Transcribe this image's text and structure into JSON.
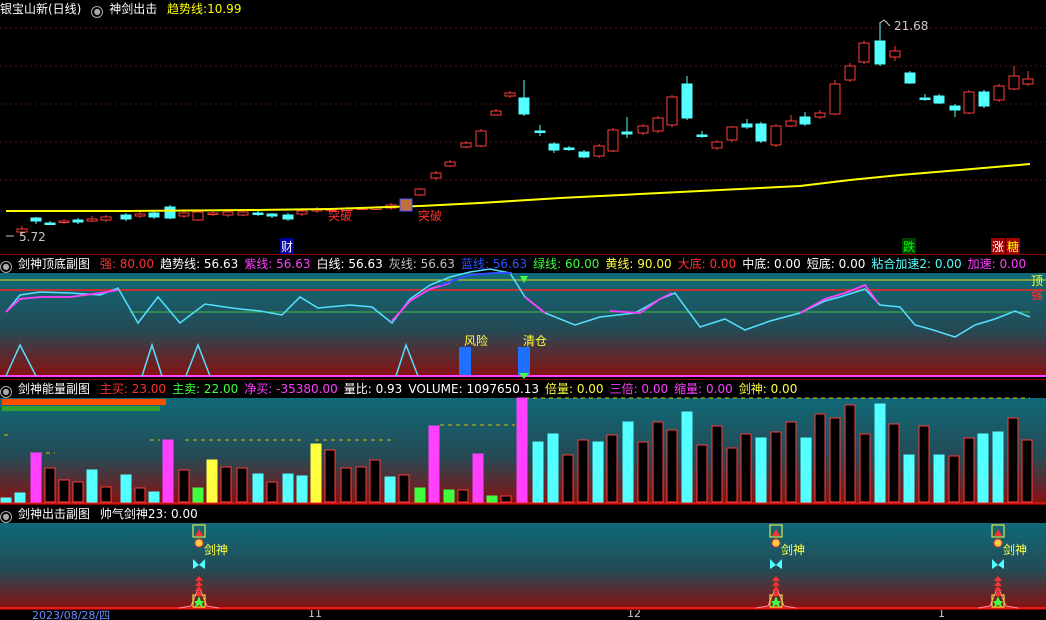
{
  "main": {
    "title": "银宝山新(日线)",
    "indicator_name": "神剑出击",
    "trend_label": "趋势线:",
    "trend_value": "10.99",
    "high_label": "21.68",
    "low_label": "5.72",
    "signal_tupo_1": "突破",
    "signal_tupo_2": "突破",
    "badge_cai": "财",
    "badge_die": "跌",
    "badge_zhang": "涨",
    "badge_tang": "糖",
    "colors": {
      "up": "#ff3c3c",
      "down": "#54ffff",
      "trend": "#ffff00"
    }
  },
  "sub1": {
    "title": "剑神顶底副图",
    "fields": [
      {
        "k": "强:",
        "v": "80.00",
        "c": "#ff3030"
      },
      {
        "k": "趋势线:",
        "v": "56.63",
        "c": "#ffffff"
      },
      {
        "k": "紫线:",
        "v": "56.63",
        "c": "#ff40ff"
      },
      {
        "k": "白线:",
        "v": "56.63",
        "c": "#ffffff"
      },
      {
        "k": "灰线:",
        "v": "56.63",
        "c": "#c0c0c0"
      },
      {
        "k": "蓝线:",
        "v": "56.63",
        "c": "#3050ff"
      },
      {
        "k": "绿线:",
        "v": "60.00",
        "c": "#40ff40"
      },
      {
        "k": "黄线:",
        "v": "90.00",
        "c": "#ffff40"
      },
      {
        "k": "大底:",
        "v": "0.00",
        "c": "#ff3030"
      },
      {
        "k": "中底:",
        "v": "0.00",
        "c": "#ffffff"
      },
      {
        "k": "短底:",
        "v": "0.00",
        "c": "#ffffff"
      },
      {
        "k": "粘合加速2:",
        "v": "0.00",
        "c": "#54ffff"
      },
      {
        "k": "加速:",
        "v": "0.00",
        "c": "#ff40ff"
      }
    ],
    "label_risk": "风险",
    "label_clear": "清仓",
    "label_top": "顶",
    "label_strong": "强"
  },
  "sub2": {
    "title": "剑神能量副图",
    "fields": [
      {
        "k": "主买:",
        "v": "23.00",
        "c": "#ff3030"
      },
      {
        "k": "主卖:",
        "v": "22.00",
        "c": "#40ff40"
      },
      {
        "k": "净买:",
        "v": "-35380.00",
        "c": "#ff40ff"
      },
      {
        "k": "量比:",
        "v": "0.93",
        "c": "#ffffff"
      },
      {
        "k": "VOLUME:",
        "v": "1097650.13",
        "c": "#ffffff"
      },
      {
        "k": "倍量:",
        "v": "0.00",
        "c": "#ffff40"
      },
      {
        "k": "三倍:",
        "v": "0.00",
        "c": "#ff40ff"
      },
      {
        "k": "缩量:",
        "v": "0.00",
        "c": "#ff40ff"
      },
      {
        "k": "剑神:",
        "v": "0.00",
        "c": "#ffff40"
      }
    ]
  },
  "sub3": {
    "title": "剑神出击副图",
    "field_k": "帅气剑神23:",
    "field_v": "0.00",
    "sword_label_1": "剑神",
    "sword_label_2": "剑神",
    "sword_label_3": "剑神"
  },
  "axis": {
    "date": "2023/08/28/四",
    "tick1": "11",
    "tick2": "12",
    "tick3": "1"
  }
}
